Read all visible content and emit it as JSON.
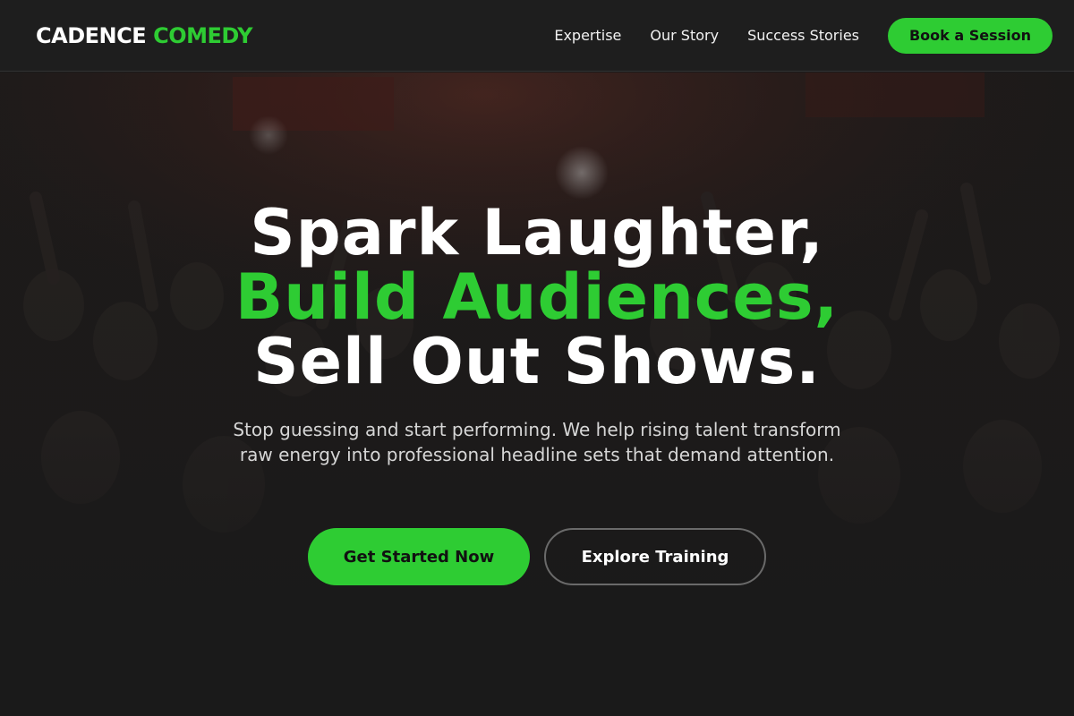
{
  "brand": {
    "part1": "CADENCE",
    "part2": "COMEDY"
  },
  "nav": {
    "items": [
      {
        "label": "Expertise"
      },
      {
        "label": "Our Story"
      },
      {
        "label": "Success Stories"
      }
    ],
    "cta_label": "Book a Session"
  },
  "hero": {
    "headline_line1": "Spark Laughter,",
    "headline_line2": "Build Audiences,",
    "headline_line3": "Sell Out Shows.",
    "subtext": "Stop guessing and start performing. We help rising talent transform raw energy into professional headline sets that demand attention.",
    "primary_cta": "Get Started Now",
    "secondary_cta": "Explore Training"
  },
  "colors": {
    "accent": "#2ecc33",
    "background": "#1a1a1a",
    "header_bg": "#1e1e1e"
  }
}
